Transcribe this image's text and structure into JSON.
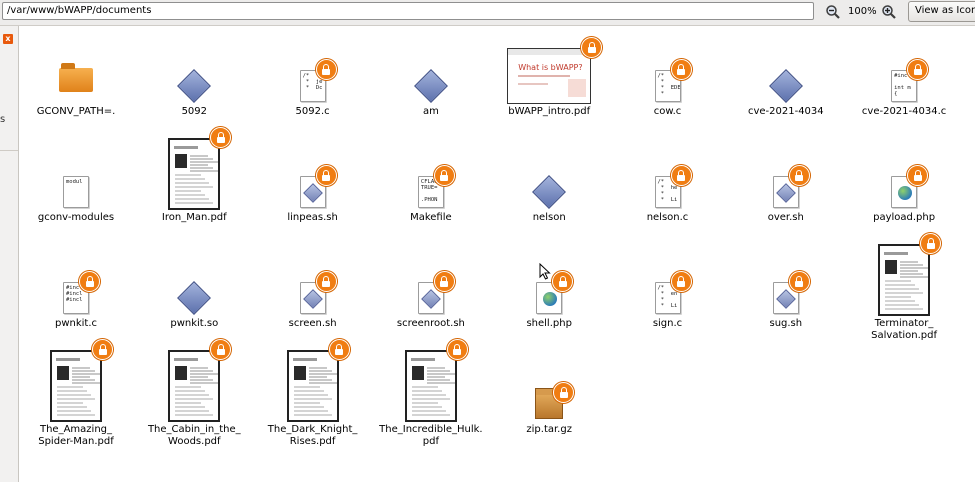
{
  "toolbar": {
    "location": "/var/www/bWAPP/documents",
    "zoom_level": "100%",
    "view_button": "View as Icons",
    "zoom_out_icon": "zoom-out-icon",
    "zoom_in_icon": "zoom-in-icon"
  },
  "sidepane": {
    "close_glyph": "x",
    "fragment": "s"
  },
  "files": [
    {
      "name": "GCONV_PATH=.",
      "icon": "folder",
      "locked": false
    },
    {
      "name": "5092",
      "icon": "exec",
      "locked": false
    },
    {
      "name": "5092.c",
      "icon": "text",
      "preview": "/*\n *  je\n *  Dc",
      "locked": true
    },
    {
      "name": "am",
      "icon": "exec",
      "locked": false
    },
    {
      "name": "bWAPP_intro.pdf",
      "icon": "bwapp-pdf",
      "preview": "What is bWAPP?",
      "locked": true
    },
    {
      "name": "cow.c",
      "icon": "text",
      "preview": "/*\n *\n *  EDE\n *",
      "locked": true
    },
    {
      "name": "cve-2021-4034",
      "icon": "exec",
      "locked": false
    },
    {
      "name": "cve-2021-4034.c",
      "icon": "text",
      "preview": "#incl\n\nint m\n{",
      "locked": true
    },
    {
      "name": "gconv-modules",
      "icon": "text",
      "preview": "modul",
      "locked": false
    },
    {
      "name": "Iron_Man.pdf",
      "icon": "pdf",
      "locked": true
    },
    {
      "name": "linpeas.sh",
      "icon": "script",
      "locked": true
    },
    {
      "name": "Makefile",
      "icon": "text",
      "preview": "CFLAG\nTRUE=\n\n.PHON",
      "locked": true
    },
    {
      "name": "nelson",
      "icon": "exec",
      "locked": false
    },
    {
      "name": "nelson.c",
      "icon": "text",
      "preview": "/*\n *  he\n *\n *  Li",
      "locked": true
    },
    {
      "name": "over.sh",
      "icon": "script",
      "locked": true
    },
    {
      "name": "payload.php",
      "icon": "php",
      "locked": true
    },
    {
      "name": "pwnkit.c",
      "icon": "text",
      "preview": "#incl\n#incl\n#incl",
      "locked": true
    },
    {
      "name": "pwnkit.so",
      "icon": "exec",
      "locked": false
    },
    {
      "name": "screen.sh",
      "icon": "script",
      "locked": true
    },
    {
      "name": "screenroot.sh",
      "icon": "script",
      "locked": true
    },
    {
      "name": "shell.php",
      "icon": "php",
      "locked": true
    },
    {
      "name": "sign.c",
      "icon": "text",
      "preview": "/*\n *  en\n *\n *  Li",
      "locked": true
    },
    {
      "name": "sug.sh",
      "icon": "script",
      "locked": true
    },
    {
      "name": "Terminator_\nSalvation.pdf",
      "icon": "pdf",
      "locked": true
    },
    {
      "name": "The_Amazing_\nSpider-Man.pdf",
      "icon": "pdf",
      "locked": true
    },
    {
      "name": "The_Cabin_in_the_\nWoods.pdf",
      "icon": "pdf",
      "locked": true
    },
    {
      "name": "The_Dark_Knight_\nRises.pdf",
      "icon": "pdf",
      "locked": true
    },
    {
      "name": "The_Incredible_Hulk.\npdf",
      "icon": "pdf",
      "locked": true
    },
    {
      "name": "zip.tar.gz",
      "icon": "archive",
      "locked": true
    }
  ]
}
